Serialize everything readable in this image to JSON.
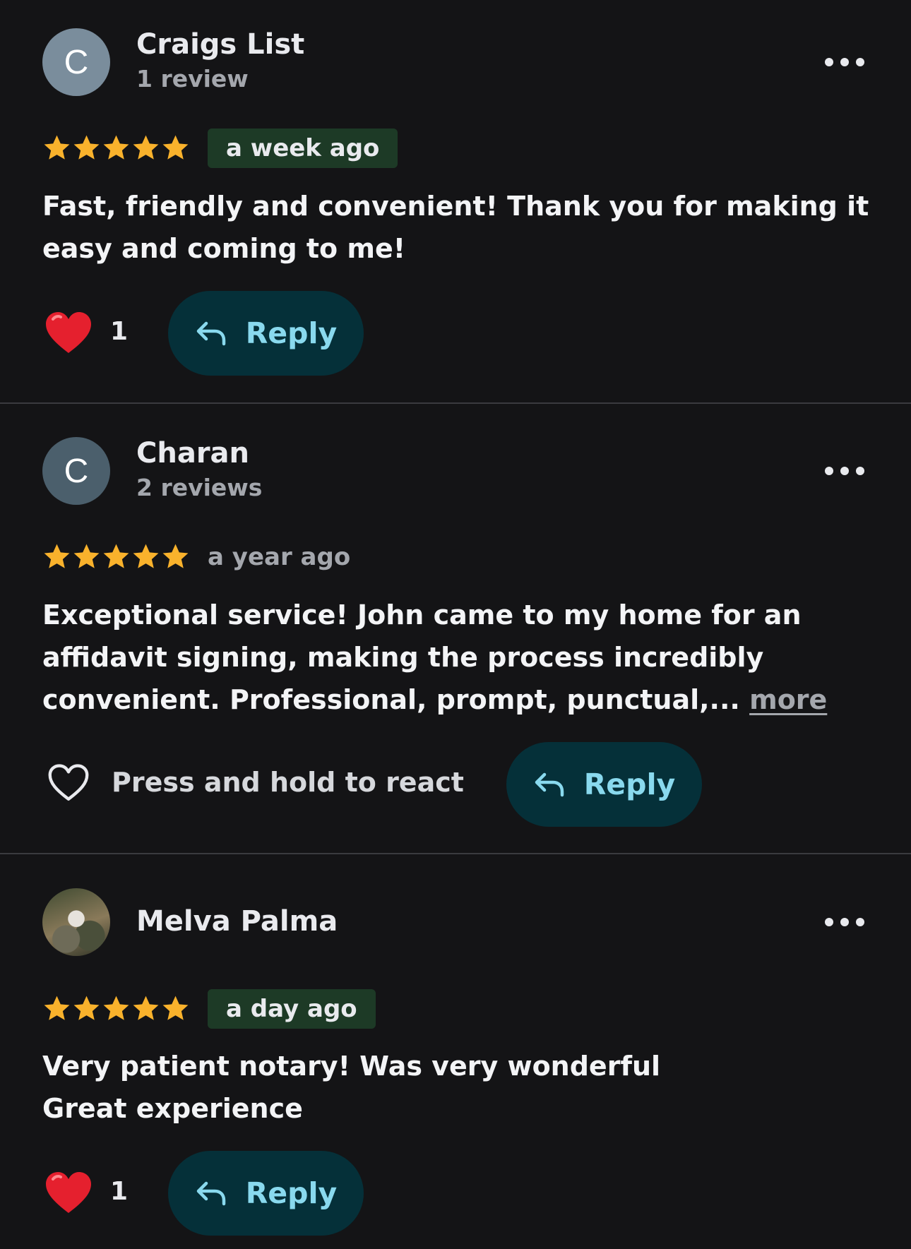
{
  "colors": {
    "background": "#141416",
    "star": "#f9b22c",
    "heart": "#e5202e",
    "reply_bg": "#053039",
    "reply_text": "#89d9ee",
    "date_badge_bg": "#1d3a26",
    "divider": "#3a3b3f"
  },
  "icons": {
    "star": "star-icon",
    "heart_filled": "heart-filled-icon",
    "heart_outline": "heart-outline-icon",
    "reply": "reply-arrow-icon",
    "menu": "more-options-icon"
  },
  "reviews": [
    {
      "avatar_letter": "C",
      "avatar_color": "#7a8d9c",
      "name": "Craigs List",
      "review_count": "1 review",
      "rating": 5,
      "date": "a week ago",
      "text": "Fast, friendly and convenient! Thank you for making it easy and coming to me!",
      "reaction_count": "1",
      "reply_label": "Reply"
    },
    {
      "avatar_letter": "C",
      "avatar_color": "#4b5f6c",
      "name": "Charan",
      "review_count": "2 reviews",
      "rating": 5,
      "date": "a year ago",
      "text": "Exceptional service! John came to my home for an affidavit signing, making the process incredibly convenient. Professional, prompt, punctual,...",
      "more_label": "more",
      "react_prompt": "Press and hold to react",
      "reply_label": "Reply"
    },
    {
      "avatar_type": "photo",
      "name": "Melva Palma",
      "rating": 5,
      "date": "a day ago",
      "text": "Very patient notary! Was very wonderful Great experience",
      "reaction_count": "1",
      "reply_label": "Reply"
    }
  ]
}
